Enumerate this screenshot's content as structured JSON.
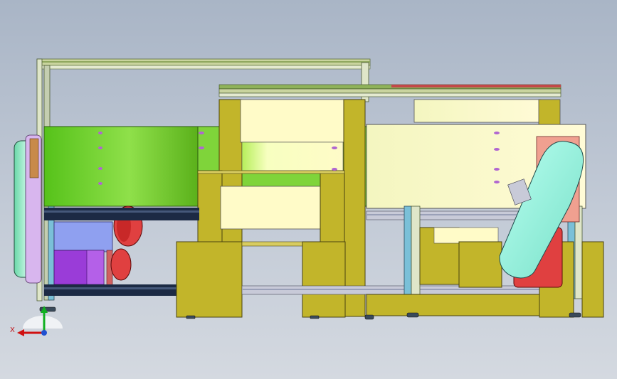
{
  "viewport": {
    "background_top": "#a9b5c6",
    "background_bottom": "#d4d9e0"
  },
  "triad": {
    "x_label": "X",
    "x_color": "#d01010",
    "y_color": "#10b020",
    "z_color": "#2050d0"
  },
  "palette": {
    "frame_profile": "#b9c79a",
    "profile_top": "#8faa6a",
    "green_plate": "#5ec21a",
    "olive_plate": "#c2b52a",
    "cream_panel": "#fffbc8",
    "teal_conveyor": "#9ff0d8",
    "red_motor": "#e04040",
    "purple_motor": "#9a3cd8",
    "blue_plate": "#8fa0f0",
    "rail_dark": "#1c2a44",
    "rail_light": "#c8cad8",
    "foot": "#2a3a4a"
  }
}
